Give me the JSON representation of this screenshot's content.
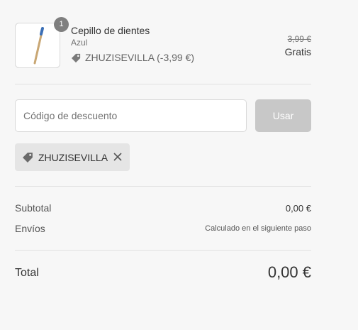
{
  "product": {
    "quantity": "1",
    "name": "Cepillo de dientes",
    "variant": "Azul",
    "discount_line": "ZHUZISEVILLA (-3,99 €)",
    "original_price": "3,99 €",
    "final_price": "Gratis"
  },
  "discount": {
    "placeholder": "Código de descuento",
    "apply_label": "Usar",
    "applied_code": "ZHUZISEVILLA"
  },
  "totals": {
    "subtotal_label": "Subtotal",
    "subtotal_value": "0,00 €",
    "shipping_label": "Envíos",
    "shipping_value": "Calculado en el siguiente paso",
    "total_label": "Total",
    "total_value": "0,00 €"
  },
  "colors": {
    "background": "#f7f7f7",
    "button_disabled": "#c8c8c8",
    "tag_background": "#e5e5e5",
    "badge": "#7f7f7f"
  },
  "icons": {
    "discount_tag": "tag-icon",
    "remove": "close-icon"
  }
}
